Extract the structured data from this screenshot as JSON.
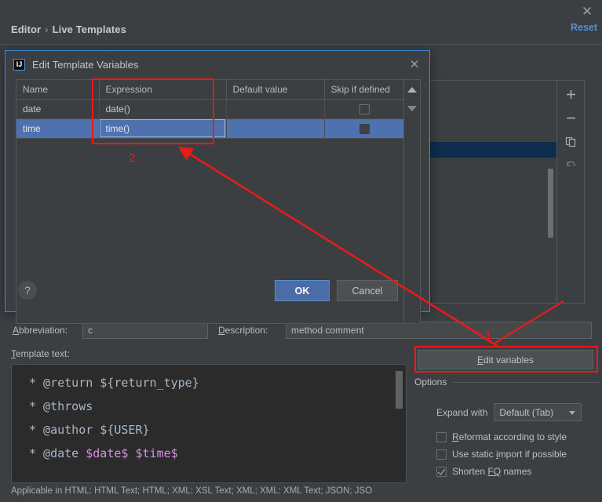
{
  "window": {
    "close_icon": "close-icon",
    "reset_label": "Reset"
  },
  "breadcrumb": {
    "root": "Editor",
    "separator": "›",
    "current": "Live Templates"
  },
  "templates_panel": {
    "toolbar": [
      {
        "name": "add-button",
        "glyph": "+"
      },
      {
        "name": "remove-button",
        "glyph": "−"
      },
      {
        "name": "duplicate-button",
        "glyph": "copy"
      },
      {
        "name": "revert-button",
        "glyph": "undo"
      }
    ]
  },
  "dialog": {
    "title": "Edit Template Variables",
    "app_icon_text": "IJ",
    "close_icon": "close-icon",
    "help_label": "?",
    "table": {
      "columns": [
        "Name",
        "Expression",
        "Default value",
        "Skip if defined"
      ],
      "rows": [
        {
          "name": "date",
          "expression": "date()",
          "default_value": "",
          "skip_if_defined": false,
          "selected": false
        },
        {
          "name": "time",
          "expression": "time()",
          "default_value": "",
          "skip_if_defined": false,
          "selected": true
        }
      ]
    },
    "move_up_label": "move-up",
    "move_down_label": "move-down",
    "buttons": {
      "ok": "OK",
      "cancel": "Cancel"
    }
  },
  "form": {
    "abbreviation_label": "Abbreviation:",
    "abbreviation_value": "c",
    "description_label": "Description:",
    "description_value": "method comment",
    "template_text_label": "Template text:",
    "template_lines": [
      {
        "prefix": "  * @return ${return_type}",
        "vars": []
      },
      {
        "prefix": "  * @throws",
        "vars": []
      },
      {
        "prefix": "  * @author ${USER}",
        "vars": []
      },
      {
        "prefix": "  * @date ",
        "vars": [
          "$date$",
          " ",
          "$time$"
        ]
      }
    ],
    "applicable_text": "Applicable in HTML: HTML Text; HTML; XML: XSL Text; XML; XML: XML Text; JSON; JSO",
    "edit_variables_label": "Edit variables"
  },
  "options": {
    "legend": "Options",
    "expand_with_label": "Expand with",
    "expand_with_value": "Default (Tab)",
    "checkboxes": [
      {
        "label": "Reformat according to style",
        "checked": false
      },
      {
        "label": "Use static import if possible",
        "checked": false
      },
      {
        "label": "Shorten FQ names",
        "checked": true
      }
    ]
  },
  "annotations": [
    {
      "number": "1",
      "target": "edit-variables-button"
    },
    {
      "number": "2",
      "target": "expression-cell"
    }
  ],
  "colors": {
    "background": "#3c3f41",
    "accent_blue": "#4d90dd",
    "selection_blue": "#4e72b0",
    "annotation_red": "#e81b1b",
    "editor_background": "#2b2b2b",
    "template_variable": "#d98fe0"
  }
}
